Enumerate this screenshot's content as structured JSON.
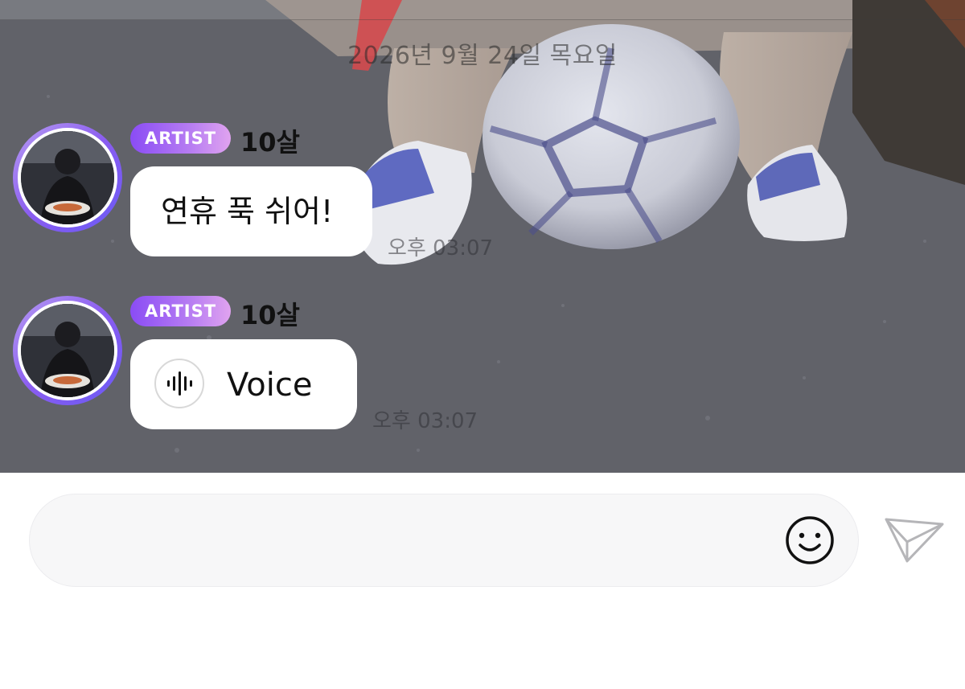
{
  "chat": {
    "date_divider": "2026년 9월 24일 목요일",
    "messages": [
      {
        "badge": "ARTIST",
        "sender": "10살",
        "text": "연휴 푹 쉬어!",
        "time": "오후 03:07",
        "type": "text"
      },
      {
        "badge": "ARTIST",
        "sender": "10살",
        "voice_label": "Voice",
        "time": "오후 03:07",
        "type": "voice"
      }
    ]
  },
  "input": {
    "value": "",
    "placeholder": ""
  },
  "icons": {
    "emoji": "smiley-face-icon",
    "send": "paper-plane-send-icon",
    "voice": "audio-waveform-icon"
  },
  "colors": {
    "badge_gradient_start": "#8a4cf5",
    "badge_gradient_end": "#e0a3f0",
    "avatar_ring": "#8a5cf0",
    "bubble": "#ffffff"
  }
}
